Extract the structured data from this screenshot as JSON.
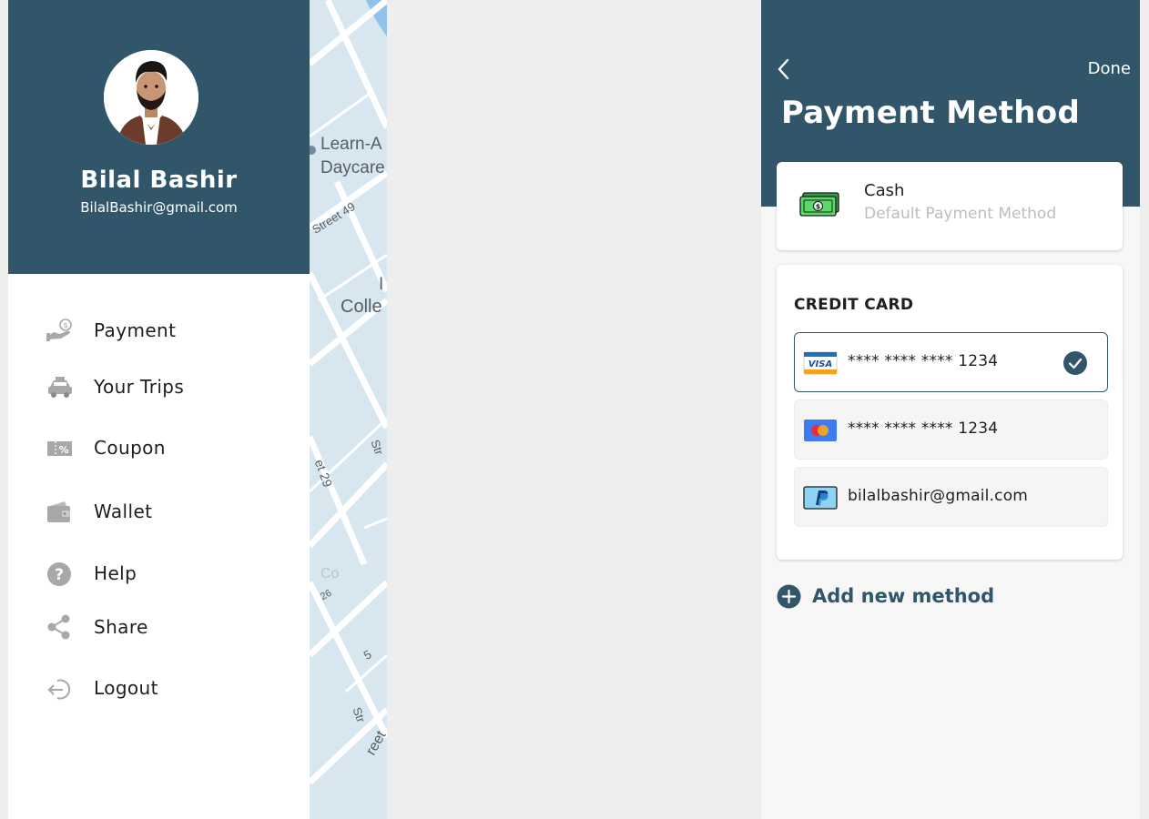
{
  "colors": {
    "header": "#31566a",
    "accent": "#31566a",
    "background": "#eeeeee",
    "muted_text": "#bdbdbd",
    "icon_gray": "#a8a8a8"
  },
  "profile": {
    "name": "Bilal Bashir",
    "email": "BilalBashir@gmail.com"
  },
  "menu": [
    {
      "label": "Payment",
      "icon": "hand-coin-icon"
    },
    {
      "label": "Your Trips",
      "icon": "car-icon"
    },
    {
      "label": "Coupon",
      "icon": "coupon-icon"
    },
    {
      "label": "Wallet",
      "icon": "wallet-icon"
    },
    {
      "label": "Help",
      "icon": "help-icon"
    },
    {
      "label": "Share",
      "icon": "share-icon"
    },
    {
      "label": "Logout",
      "icon": "logout-icon"
    }
  ],
  "map": {
    "labels": [
      "Learn-A",
      "Daycare",
      "Street 49",
      "I",
      "Colle",
      "Str",
      "et 29",
      "Co",
      "26",
      "5",
      "Str",
      "reet"
    ]
  },
  "payment": {
    "back_icon": "chevron-left-icon",
    "done_label": "Done",
    "title": "Payment Method",
    "cash": {
      "title": "Cash",
      "subtitle": "Default Payment Method",
      "icon": "cash-icon"
    },
    "credit_card_heading": "CREDIT CARD",
    "methods": [
      {
        "brand": "visa",
        "masked": "**** **** ****",
        "last4": "1234",
        "selected": true
      },
      {
        "brand": "mastercard",
        "masked": "**** **** ****",
        "last4": "1234",
        "selected": false
      },
      {
        "brand": "paypal",
        "masked": "",
        "last4": "bilalbashir@gmail.com",
        "selected": false
      }
    ],
    "visa_logo_text": "VISA",
    "add_label": "Add new method"
  }
}
